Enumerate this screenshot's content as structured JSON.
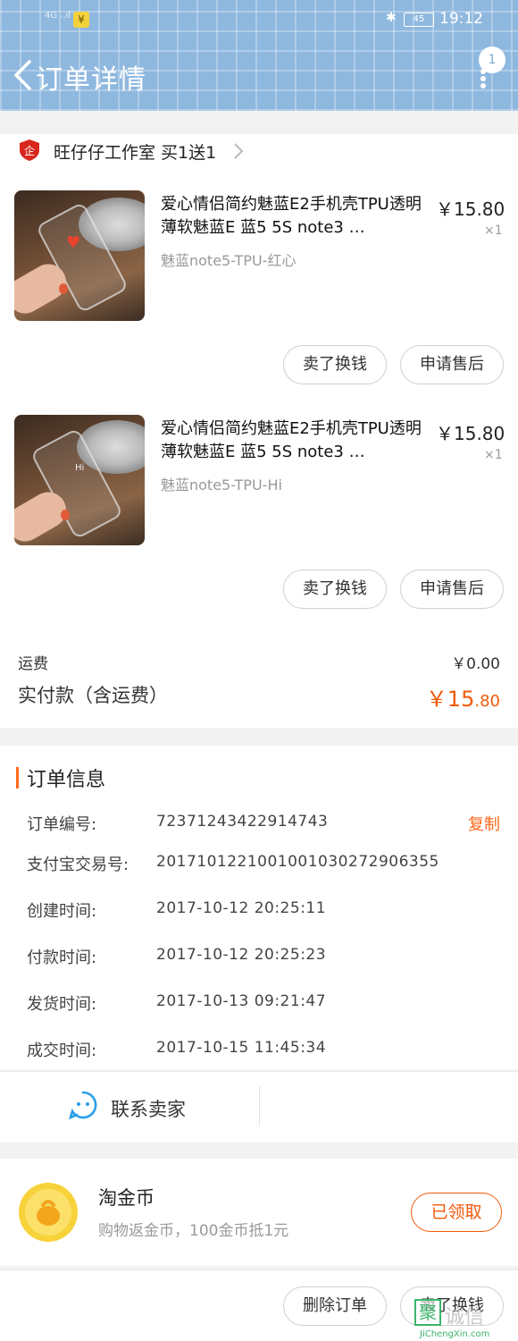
{
  "status_bar": {
    "signal": "4G ..ıl",
    "yen": "¥",
    "battery": "45",
    "time": "19:12"
  },
  "header": {
    "title": "订单详情",
    "badge_count": "1"
  },
  "shop": {
    "name": "旺仔仔工作室 买1送1",
    "icon_text": "企"
  },
  "products": [
    {
      "title": "爱心情侣简约魅蓝E2手机壳TPU透明薄软魅蓝E 蓝5 5S note3 …",
      "sku": "魅蓝note5-TPU-红心",
      "price": "￥15.80",
      "qty": "×1",
      "btn_sell": "卖了换钱",
      "btn_after_sale": "申请售后"
    },
    {
      "title": "爱心情侣简约魅蓝E2手机壳TPU透明薄软魅蓝E 蓝5 5S note3 …",
      "sku": "魅蓝note5-TPU-Hi",
      "price": "￥15.80",
      "qty": "×1",
      "btn_sell": "卖了换钱",
      "btn_after_sale": "申请售后"
    }
  ],
  "fees": {
    "shipping_label": "运费",
    "shipping_value": "￥0.00",
    "paid_label": "实付款（含运费）",
    "paid_currency_int": "￥15",
    "paid_decimal": ".80"
  },
  "order_info": {
    "title": "订单信息",
    "copy_label": "复制",
    "rows": [
      {
        "label": "订单编号:",
        "value": "72371243422914743"
      },
      {
        "label": "支付宝交易号:",
        "value": "2017101221001001030272906355"
      },
      {
        "label": "创建时间:",
        "value": "2017-10-12 20:25:11"
      },
      {
        "label": "付款时间:",
        "value": "2017-10-12 20:25:23"
      },
      {
        "label": "发货时间:",
        "value": "2017-10-13 09:21:47"
      },
      {
        "label": "成交时间:",
        "value": "2017-10-15 11:45:34"
      }
    ]
  },
  "contact": {
    "label": "联系卖家"
  },
  "coin": {
    "title": "淘金币",
    "desc": "购物返金币，100金币抵1元",
    "button": "已领取"
  },
  "bottom": {
    "delete_label": "删除订单",
    "sell_label": "卖了换钱"
  },
  "watermark": {
    "box": "聚",
    "text": "诚信",
    "url": "JiChengXin.com"
  },
  "colors": {
    "accent": "#f15a0c",
    "header_bg": "#8fb8df",
    "link_orange": "#ff6a1a"
  }
}
